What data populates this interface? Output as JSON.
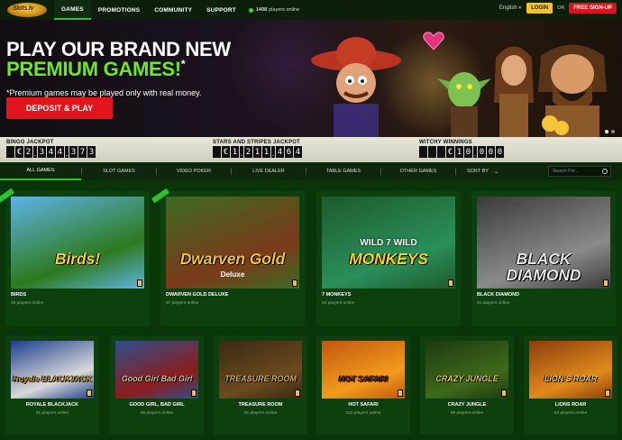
{
  "header": {
    "logo_text": "Slots.lv",
    "nav": [
      {
        "label": "GAMES",
        "active": true
      },
      {
        "label": "PROMOTIONS",
        "active": false
      },
      {
        "label": "COMMUNITY",
        "active": false
      },
      {
        "label": "SUPPORT",
        "active": false
      }
    ],
    "online_count": "1408",
    "online_label": "players online",
    "language": "English",
    "login_label": "LOGIN",
    "or_label": "OR",
    "signup_label": "FREE SIGN-UP"
  },
  "hero": {
    "title_line1": "PLAY OUR BRAND NEW",
    "title_line2": "PREMIUM GAMES!",
    "title_asterisk": "*",
    "note": "*Premium games may be played only with real money.",
    "cta_label": "DEPOSIT & PLAY",
    "slides": 2,
    "active_slide": 1
  },
  "jackpots": [
    {
      "label": "BINGO JACKPOT",
      "currency": "€",
      "value": "2,344,373"
    },
    {
      "label": "STARS AND STRIPES JACKPOT",
      "currency": "€",
      "value": "1,211,464"
    },
    {
      "label": "WITCHY WINNINGS",
      "currency": "€",
      "value": "10,000"
    }
  ],
  "filters": {
    "tabs": [
      "ALL GAMES",
      "SLOT GAMES",
      "VIDEO POKER",
      "LIVE DEALER",
      "TABLE GAMES",
      "OTHER GAMES"
    ],
    "active_tab": "ALL GAMES",
    "sort_label": "SORT BY",
    "search_placeholder": "Search For..."
  },
  "games_row1": [
    {
      "name": "BIRDS",
      "players": "38 players online",
      "art": "Birds!",
      "new": true,
      "colors": [
        "#5fb4e6",
        "#2d7a1d",
        "#f2d23a"
      ]
    },
    {
      "name": "DWARVEN GOLD DELUXE",
      "players": "67 players online",
      "art": "Dwarven Gold",
      "art_sub": "Deluxe",
      "new": true,
      "colors": [
        "#3c6b22",
        "#7b3a1a",
        "#f4c43a"
      ]
    },
    {
      "name": "7 MONKEYS",
      "players": "91 players online",
      "art": "MONKEYS",
      "art_top": "WILD 7 WILD",
      "new": false,
      "colors": [
        "#1e5a2c",
        "#2a8f5a",
        "#f5d80e"
      ]
    },
    {
      "name": "BLACK DIAMOND",
      "players": "31 players online",
      "art": "BLACK DIAMOND",
      "new": false,
      "colors": [
        "#3a3a3a",
        "#8a8a8a",
        "#e5e5e5"
      ]
    }
  ],
  "games_row2": [
    {
      "name": "ROYALE BLACKJACK",
      "players": "51 players online",
      "art": "Royale BLACKJACK",
      "colors": [
        "#1e3f8c",
        "#d9d9d9",
        "#c8a34a"
      ]
    },
    {
      "name": "GOOD GIRL, BAD GIRL",
      "players": "95 players online",
      "art": "Good Girl Bad Girl",
      "colors": [
        "#2d4f8c",
        "#8c1d1d",
        "#e8c0a0"
      ]
    },
    {
      "name": "TREASURE ROOM",
      "players": "91 players online",
      "art": "TREASURE ROOM",
      "colors": [
        "#3b2a14",
        "#6b4a1e",
        "#d9b25a"
      ]
    },
    {
      "name": "HOT SAFARI",
      "players": "101 players online",
      "art": "HOT SAFARI",
      "colors": [
        "#c2560f",
        "#f29b1c",
        "#6b2a08"
      ]
    },
    {
      "name": "CRAZY JUNGLE",
      "players": "86 players online",
      "art": "CRAZY JUNGLE",
      "colors": [
        "#1d3a12",
        "#3e6a1a",
        "#e5d24a"
      ]
    },
    {
      "name": "LIONS ROAR",
      "players": "63 players online",
      "art": "LION'S ROAR",
      "colors": [
        "#8c3d0c",
        "#e08a1c",
        "#f4d05a"
      ]
    }
  ],
  "colors": {
    "accent_green": "#2ec22e",
    "cta_red": "#e2141c",
    "login_yellow": "#f4c230"
  }
}
